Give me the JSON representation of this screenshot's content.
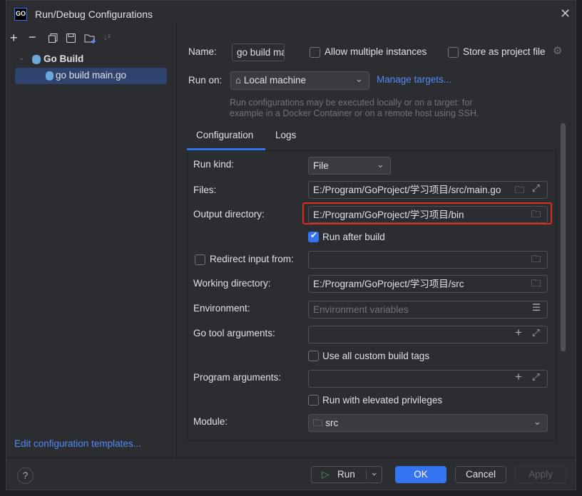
{
  "window": {
    "title": "Run/Debug Configurations",
    "logo": "GO"
  },
  "toolbar": {
    "icons": [
      "plus-icon",
      "minus-icon",
      "copy-icon",
      "save-icon",
      "new-folder-icon",
      "sort-icon"
    ]
  },
  "tree": {
    "group": "Go Build",
    "item": "go build main.go"
  },
  "sidebar": {
    "edit_templates": "Edit configuration templates..."
  },
  "header": {
    "name_label": "Name:",
    "name_value": "go build main.go",
    "allow_multiple": "Allow multiple instances",
    "allow_multiple_checked": false,
    "store_project": "Store as project file",
    "store_project_checked": false,
    "run_on_label": "Run on:",
    "run_on_value": "Local machine",
    "manage_targets": "Manage targets...",
    "hint": "Run configurations may be executed locally or on a target: for example in a Docker Container or on a remote host using SSH."
  },
  "tabs": [
    {
      "label": "Configuration",
      "active": true
    },
    {
      "label": "Logs",
      "active": false
    }
  ],
  "form": {
    "run_kind_label": "Run kind:",
    "run_kind_value": "File",
    "files_label": "Files:",
    "files_value": "E:/Program/GoProject/学习项目/src/main.go",
    "output_label": "Output directory:",
    "output_value": "E:/Program/GoProject/学习项目/bin",
    "run_after_build": "Run after build",
    "run_after_build_checked": true,
    "redirect_label": "Redirect input from:",
    "redirect_checked": false,
    "redirect_value": "",
    "working_label": "Working directory:",
    "working_value": "E:/Program/GoProject/学习项目/src",
    "env_label": "Environment:",
    "env_placeholder": "Environment variables",
    "go_tool_label": "Go tool arguments:",
    "go_tool_value": "",
    "custom_tags": "Use all custom build tags",
    "custom_tags_checked": false,
    "program_label": "Program arguments:",
    "program_value": "",
    "elevated": "Run with elevated privileges",
    "elevated_checked": false,
    "module_label": "Module:",
    "module_value": "src"
  },
  "footer": {
    "help": "?",
    "run": "Run",
    "ok": "OK",
    "cancel": "Cancel",
    "apply": "Apply"
  },
  "colors": {
    "accent": "#3574f0",
    "highlight": "#e0291f",
    "selection": "#2e436e",
    "link": "#548af7"
  }
}
